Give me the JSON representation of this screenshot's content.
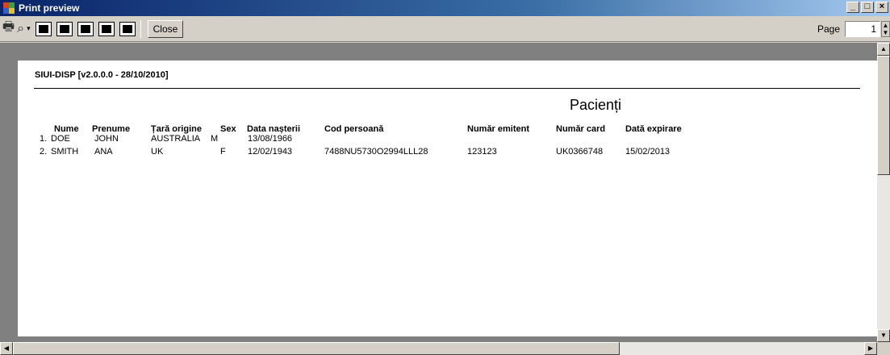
{
  "window": {
    "title": "Print preview"
  },
  "toolbar": {
    "close_label": "Close",
    "page_label": "Page",
    "page_value": "1"
  },
  "report": {
    "header": "SIUI-DISP [v2.0.0.0 - 28/10/2010]",
    "title": "Pacienți",
    "columns": [
      "Nume",
      "Prenume",
      "Țară origine",
      "Sex",
      "Data nașterii",
      "Cod persoană",
      "Număr emitent",
      "Număr card",
      "Dată expirare"
    ],
    "rows": [
      {
        "index": "1.",
        "cells": [
          "DOE",
          "JOHN",
          "AUSTRALIA",
          "M",
          "13/08/1966",
          "",
          "",
          "",
          ""
        ]
      },
      {
        "index": "2.",
        "cells": [
          "SMITH",
          "ANA",
          "UK",
          "F",
          "12/02/1943",
          "7488NU5730O2994LLL28",
          "123123",
          "UK0366748",
          "15/02/2013"
        ]
      }
    ]
  },
  "colors": {
    "title_bar_start": "#0a246a",
    "title_bar_end": "#a6caf0",
    "frame": "#d4d0c8",
    "viewport_bg": "#808080"
  }
}
